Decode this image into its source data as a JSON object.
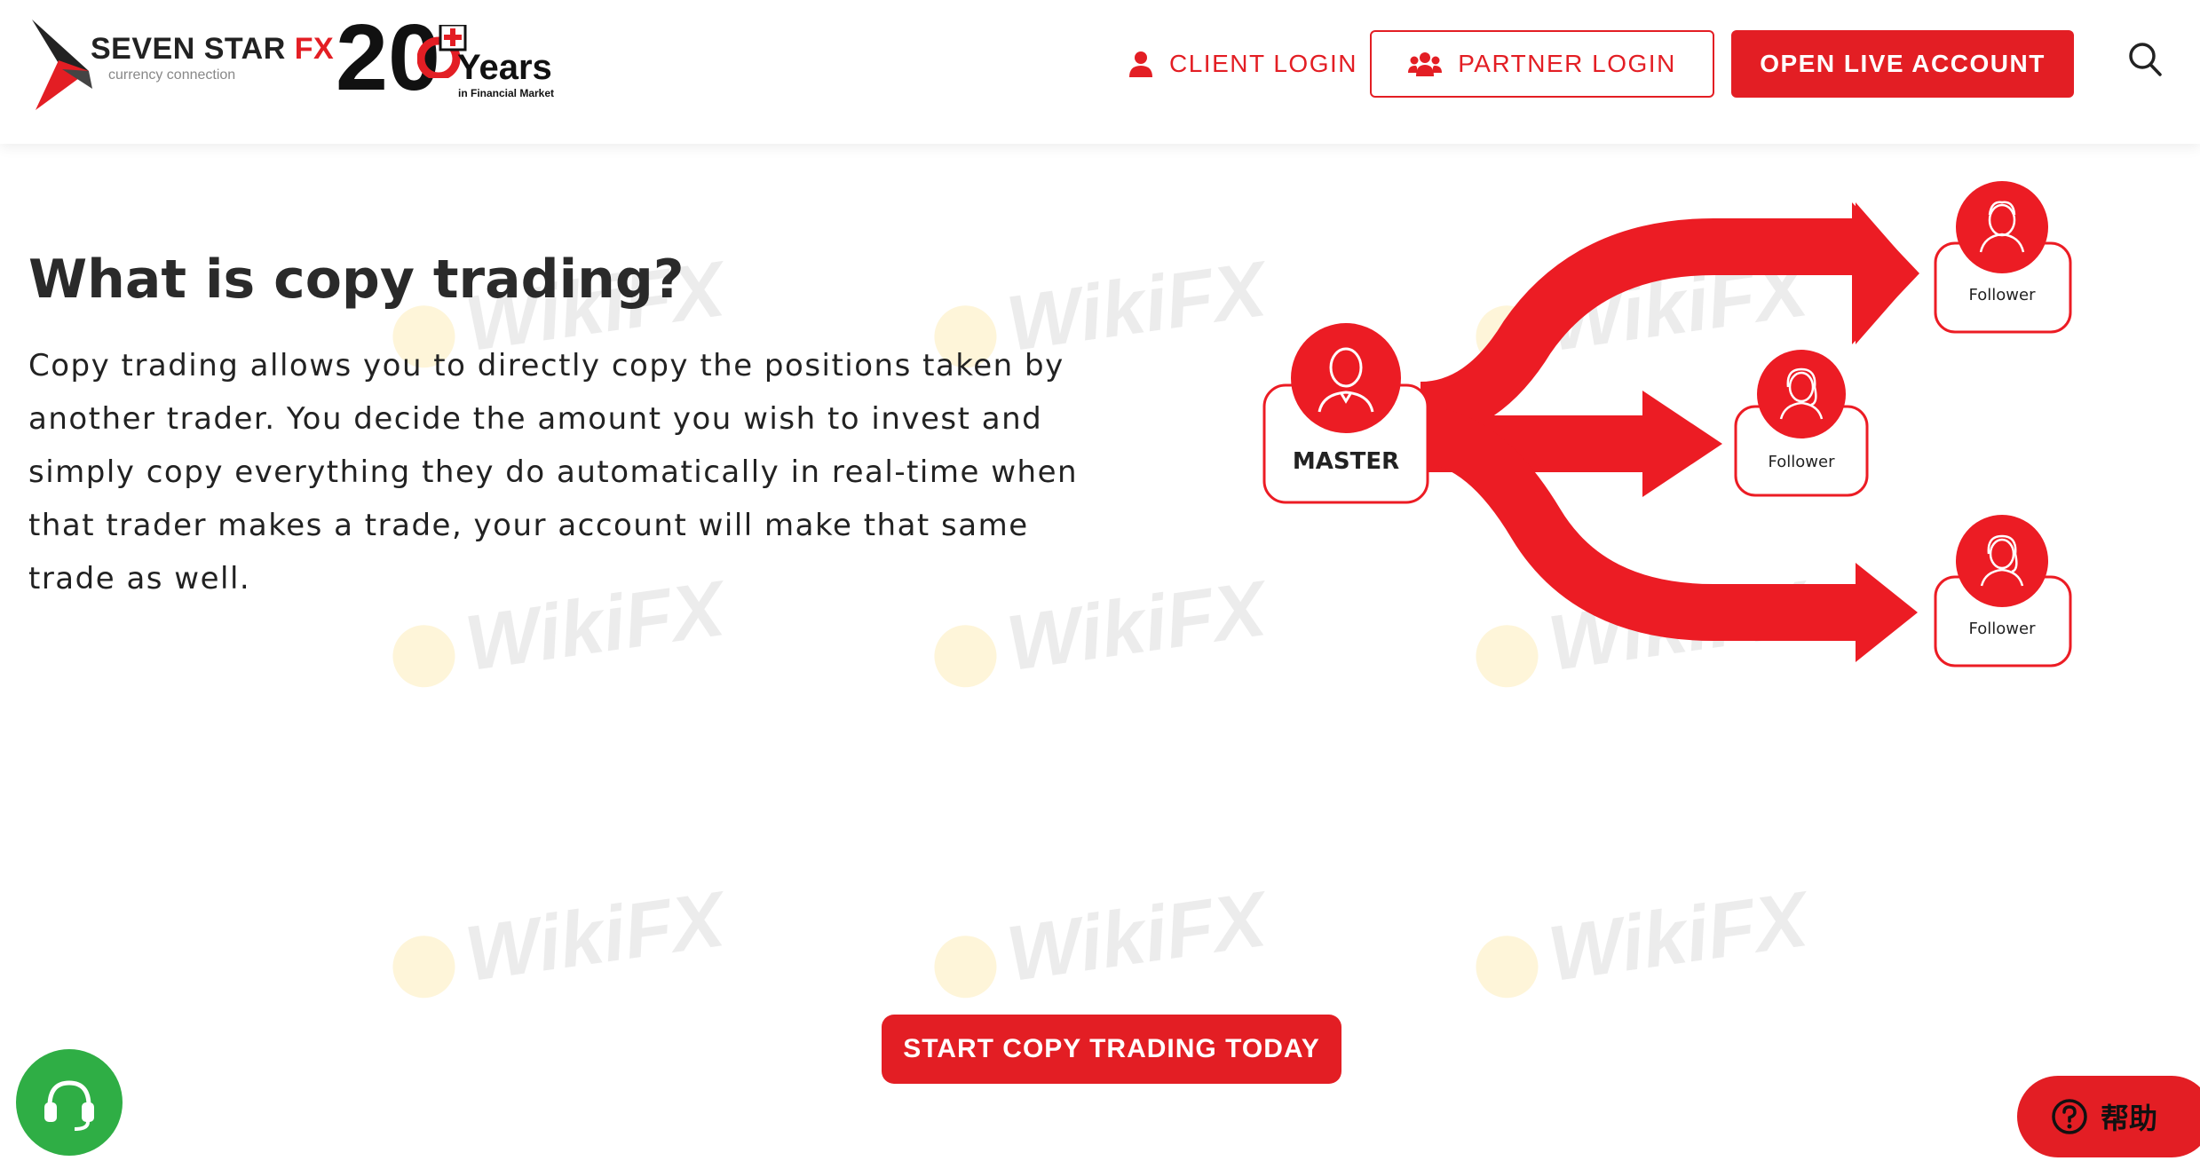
{
  "header": {
    "logo": {
      "brand": "SEVEN STAR",
      "brand_accent": "FX",
      "tagline": "currency connection"
    },
    "anniversary": {
      "number": "20",
      "label": "Years",
      "sub": "in Financial Market"
    },
    "nav": {
      "client_login": "CLIENT LOGIN",
      "partner_login": "PARTNER LOGIN",
      "open_live_account": "OPEN LIVE ACCOUNT"
    }
  },
  "main": {
    "title": "What is copy trading?",
    "description": "Copy trading allows you to directly copy the positions taken by another trader. You decide the amount you wish to invest and simply copy everything they do automatically in real-time when that trader makes a trade, your account will make that same trade as well.",
    "diagram": {
      "master_label": "MASTER",
      "follower_top": "Follower",
      "follower_middle": "Follower",
      "follower_bottom": "Follower"
    },
    "cta": "START COPY TRADING TODAY"
  },
  "widgets": {
    "help_label": "帮助"
  },
  "watermark": "WikiFX",
  "colors": {
    "accent": "#e31e24",
    "support": "#2fae45",
    "text": "#222222"
  },
  "icons": [
    "user-icon",
    "users-icon",
    "search-icon",
    "headset-icon",
    "question-icon"
  ]
}
